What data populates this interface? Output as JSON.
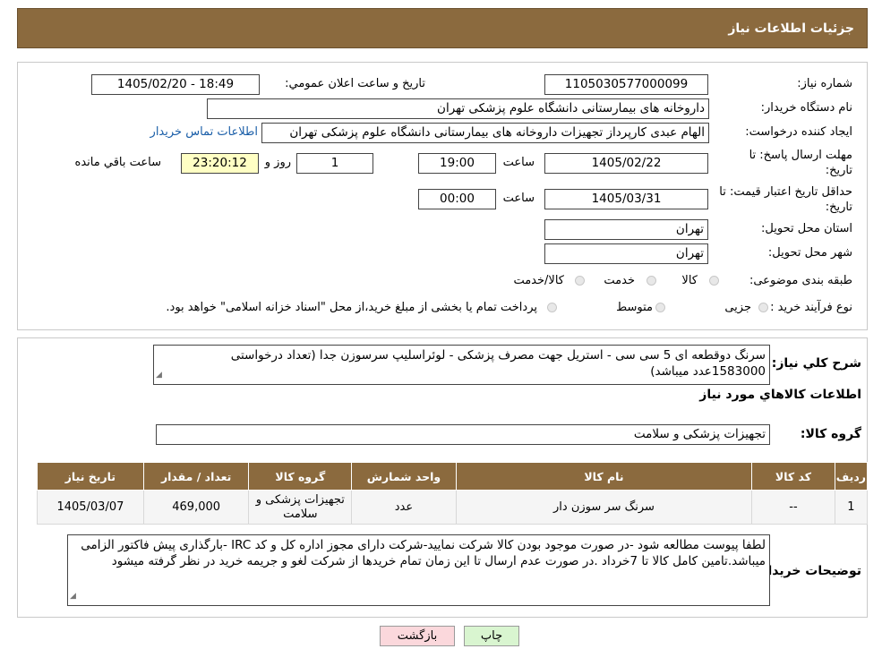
{
  "header": {
    "title": "جزئیات اطلاعات نیاز"
  },
  "form": {
    "need_number_label": "شماره نیاز:",
    "need_number": "1105030577000099",
    "announce_label": "تاریخ و ساعت اعلان عمومي:",
    "announce_value": "1405/02/20 - 18:49",
    "buyer_org_label": "نام دستگاه خریدار:",
    "buyer_org": "داروخانه های بیمارستانی دانشگاه علوم پزشکی تهران",
    "creator_label": "ایجاد کننده درخواست:",
    "creator": "الهام عبدی کارپرداز تجهیزات داروخانه های بیمارستانی دانشگاه علوم پزشکی تهران",
    "contact_link": "اطلاعات تماس خریدار",
    "deadline_label_1": "مهلت ارسال پاسخ: تا",
    "deadline_label_2": "تاریخ:",
    "deadline_date": "1405/02/22",
    "time_label": "ساعت",
    "deadline_time": "19:00",
    "days_value": "1",
    "days_label": "روز و",
    "remaining_time": "23:20:12",
    "remaining_label": "ساعت باقي مانده",
    "validity_label_1": "حداقل تاریخ اعتبار قیمت: تا",
    "validity_label_2": "تاریخ:",
    "validity_date": "1405/03/31",
    "validity_time": "00:00",
    "province_label": "استان محل تحویل:",
    "province": "تهران",
    "city_label": "شهر محل تحویل:",
    "city": "تهران",
    "category_label": "طبقه بندی موضوعی:",
    "category_options": [
      "کالا",
      "خدمت",
      "کالا/خدمت"
    ],
    "purchase_type_label": "نوع فرآیند خرید :",
    "purchase_options": [
      "جزیی",
      "متوسط"
    ],
    "purchase_note": "پرداخت تمام یا بخشی از مبلغ خرید،از محل \"اسناد خزانه اسلامی\" خواهد بود."
  },
  "details": {
    "summary_label": "شرح کلي نیاز:",
    "summary": "سرنگ دوقطعه ای 5 سی سی - استریل جهت مصرف پزشکی - لوئراسلیپ سرسوزن جدا (تعداد درخواستی 1583000عدد میباشد)",
    "goods_info_title": "اطلاعات کالاهاي مورد نیاز",
    "goods_group_label": "گروه کالا:",
    "goods_group": "تجهیزات پزشکی و سلامت",
    "table": {
      "headers": [
        "ردیف",
        "کد کالا",
        "نام کالا",
        "واحد شمارش",
        "گروه کالا",
        "تعداد / مقدار",
        "تاریخ نیاز"
      ],
      "rows": [
        [
          "1",
          "--",
          "سرنگ سر سوزن دار",
          "عدد",
          "تجهیزات پزشکی و سلامت",
          "469,000",
          "1405/03/07"
        ]
      ]
    },
    "buyer_notes_label": "توضیحات خریدار:",
    "buyer_notes": "لطفا پیوست مطالعه شود -در صورت موجود بودن کالا شرکت نمایید-شرکت دارای مجوز اداره کل و کد IRC -بارگذاری پیش فاکتور الزامی میباشد.تامین کامل کالا تا 7خرداد .در صورت عدم ارسال تا این زمان تمام خریدها از شرکت لغو و جریمه خرید در نظر گرفته میشود"
  },
  "buttons": {
    "print": "چاپ",
    "back": "بازگشت"
  },
  "colors": {
    "header_bg": "#8b6a3e",
    "remaining_bg": "#ffffc4",
    "back_btn_bg": "#fbd8dc",
    "print_btn_bg": "#d9f5d0"
  }
}
